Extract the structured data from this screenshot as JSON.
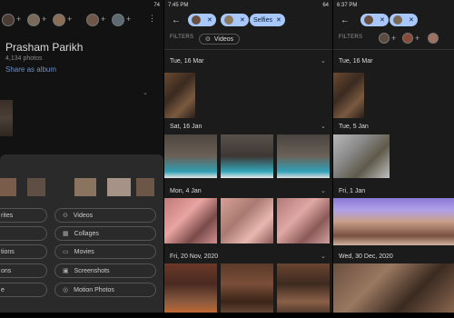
{
  "panel1": {
    "status_time": "",
    "status_right": "74",
    "person_name": "Prasham Parikh",
    "photo_count": "4,134 photos",
    "share_label": "Share as album",
    "chips": [
      {
        "label": "rites",
        "icon": "star-icon"
      },
      {
        "label": "Videos",
        "icon": "video-icon"
      },
      {
        "label": "",
        "icon": "album-icon"
      },
      {
        "label": "Collages",
        "icon": "collage-icon"
      },
      {
        "label": "tions",
        "icon": "animation-icon"
      },
      {
        "label": "Movies",
        "icon": "movie-icon"
      },
      {
        "label": "ons",
        "icon": "cinematic-icon"
      },
      {
        "label": "Screenshots",
        "icon": "screenshot-icon"
      },
      {
        "label": "e",
        "icon": "selfie-icon"
      },
      {
        "label": "Motion Photos",
        "icon": "motion-icon"
      }
    ]
  },
  "panel2": {
    "status_time": "7:45 PM",
    "status_right": "64",
    "selfies_label": "Selfies",
    "filters_label": "FILTERS",
    "videos_label": "Videos",
    "dates": [
      "Tue, 16 Mar",
      "Sat, 16 Jan",
      "Mon, 4 Jan",
      "Fri, 20 Nov, 2020"
    ]
  },
  "panel3": {
    "status_time": "6:37 PM",
    "filters_label": "FILTERS",
    "dates": [
      "Tue, 16 Mar",
      "Tue, 5 Jan",
      "Fri, 1 Jan",
      "Wed, 30 Dec, 2020"
    ]
  },
  "colors": {
    "chip_blue": "#a8c7fa",
    "link_blue": "#6c8fc5"
  }
}
